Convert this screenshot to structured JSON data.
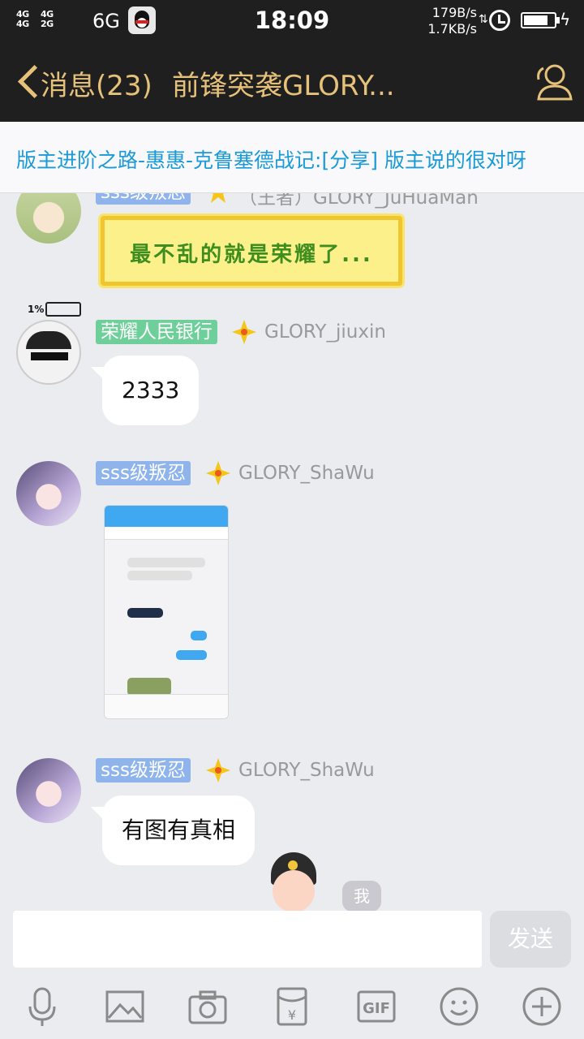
{
  "status_bar": {
    "signal_1": "4G\n4G",
    "signal_2": "4G\n2G",
    "network": "6G",
    "time": "18:09",
    "speed_up": "179B/s",
    "speed_down": "1.7KB/s",
    "battery_level": 0.8
  },
  "header": {
    "back_label": "消息(23)",
    "title": "前锋突袭GLORY..."
  },
  "announcement": "版主进阶之路-惠惠-克鲁塞德战记:[分享] 版主说的很对呀",
  "messages": [
    {
      "tag": "sss级叛忍",
      "nick": "（王者）GLORY_JuHuaMan",
      "sticker_text": "最不乱的就是荣耀了..."
    },
    {
      "tag": "荣耀人民银行",
      "nick": "GLORY_jiuxin",
      "text": "2333",
      "battery_deco": "1%"
    },
    {
      "tag": "sss级叛忍",
      "nick": "GLORY_ShaWu",
      "image": "chat-screenshot"
    },
    {
      "tag": "sss级叛忍",
      "nick": "GLORY_ShaWu",
      "text": "有图有真相"
    }
  ],
  "me_label": "我",
  "input": {
    "value": "",
    "send_label": "发送"
  },
  "toolbar": {
    "icons": [
      "microphone-icon",
      "image-icon",
      "camera-icon",
      "red-packet-icon",
      "gif-icon",
      "emoji-icon",
      "plus-icon"
    ],
    "gif_label": "GIF"
  },
  "colors": {
    "header_bg": "#1f1f1f",
    "header_text": "#e5c17a",
    "notice_text": "#1a9ad6",
    "tag_blue": "#8fb4ec",
    "tag_green": "#6fcf9a"
  }
}
